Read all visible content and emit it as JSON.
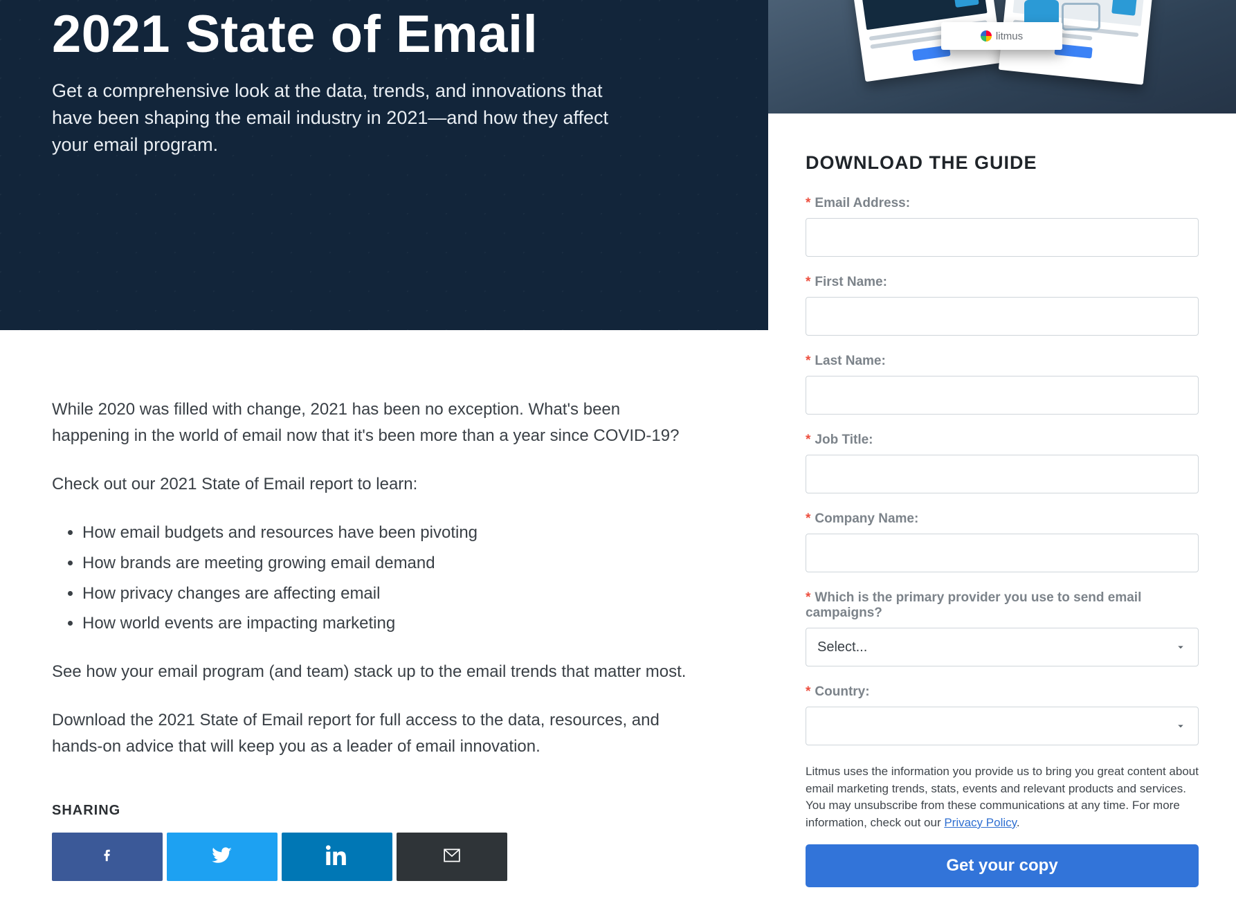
{
  "hero": {
    "title": "2021 State of Email",
    "subtitle": "Get a comprehensive look at the data, trends, and innovations that have been shaping the email industry in 2021—and how they affect your email program."
  },
  "content": {
    "intro": "While 2020 was filled with change, 2021 has been no exception. What's been happening in the world of email now that it's been more than a year since COVID-19?",
    "lead_in": "Check out our 2021 State of Email report to learn:",
    "bullets": [
      "How email budgets and resources have been pivoting",
      "How brands are meeting growing email demand",
      "How privacy changes are affecting email",
      "How world events are impacting marketing"
    ],
    "closing1": "See how your email program (and team) stack up to the email trends that matter most.",
    "closing2": "Download the 2021 State of Email report for full access to the data, resources, and hands-on advice that will keep you as a leader of email innovation."
  },
  "sharing": {
    "heading": "SHARING"
  },
  "preview": {
    "brand": "litmus"
  },
  "form": {
    "heading": "DOWNLOAD THE GUIDE",
    "fields": {
      "email": {
        "label": "Email Address:",
        "value": "",
        "required": true
      },
      "first_name": {
        "label": "First Name:",
        "value": "",
        "required": true
      },
      "last_name": {
        "label": "Last Name:",
        "value": "",
        "required": true
      },
      "job_title": {
        "label": "Job Title:",
        "value": "",
        "required": true
      },
      "company": {
        "label": "Company Name:",
        "value": "",
        "required": true
      },
      "provider": {
        "label": "Which is the primary provider you use to send email campaigns?",
        "value": "Select...",
        "required": true
      },
      "country": {
        "label": "Country:",
        "value": "",
        "required": true
      }
    },
    "provider_placeholder": "Select...",
    "disclaimer_pre": "Litmus uses the information you provide us to bring you great content about email marketing trends, stats, events and relevant products and services. You may unsubscribe from these communications at any time. For more information, check out our ",
    "disclaimer_link": "Privacy Policy",
    "disclaimer_post": ".",
    "submit": "Get your copy"
  }
}
